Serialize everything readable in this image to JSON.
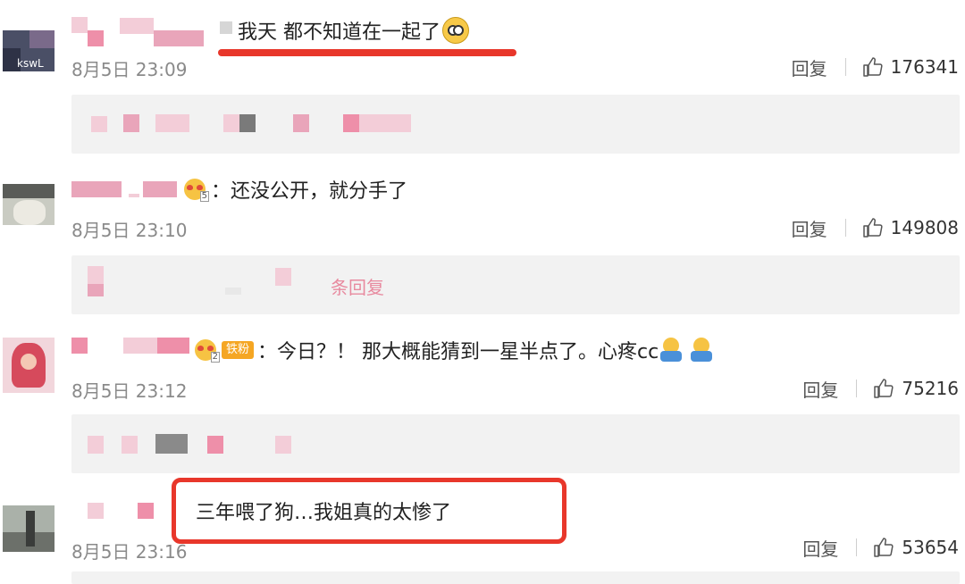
{
  "comments": [
    {
      "text": "我天 都不知道在一起了",
      "time": "8月5日 23:09",
      "reply_label": "回复",
      "likes": "176341",
      "avatar_tag": "kswL"
    },
    {
      "text": "还没公开，就分手了",
      "time": "8月5日 23:10",
      "reply_label": "回复",
      "likes": "149808",
      "badge_level": "5",
      "more_replies": "条回复"
    },
    {
      "text": "今日？！ 那大概能猜到一星半点了。心疼cc",
      "time": "8月5日 23:12",
      "reply_label": "回复",
      "likes": "75216",
      "fan_badge": "铁粉",
      "badge_level": "2"
    },
    {
      "text": "三年喂了狗…我姐真的太惨了",
      "time": "8月5日 23:16",
      "reply_label": "回复",
      "likes": "53654"
    }
  ],
  "colors": {
    "highlight_red": "#e8372b",
    "mosaic_pink": "#e9a5ba",
    "subreply_bg": "#f2f2f2"
  }
}
